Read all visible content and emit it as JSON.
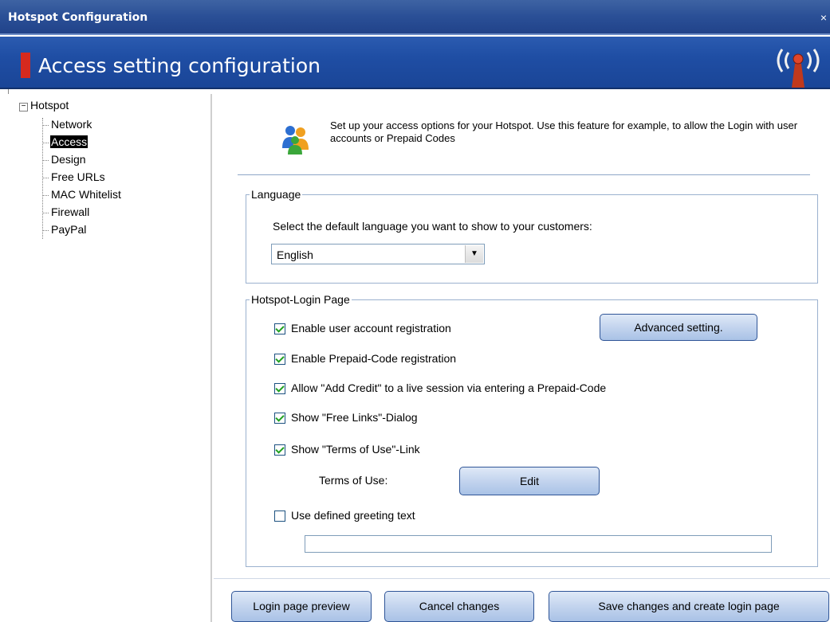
{
  "window": {
    "title": "Hotspot Configuration",
    "close_glyph": "×"
  },
  "header": {
    "title": "Access setting configuration",
    "icon": "antenna-icon"
  },
  "tree": {
    "root": "Hotspot",
    "items": [
      {
        "label": "Network"
      },
      {
        "label": "Access",
        "selected": true
      },
      {
        "label": "Design"
      },
      {
        "label": "Free URLs"
      },
      {
        "label": "MAC Whitelist"
      },
      {
        "label": "Firewall"
      },
      {
        "label": "PayPal"
      }
    ]
  },
  "info": {
    "icon": "users-icon",
    "text": "Set up your access options for your Hotspot. Use this feature for example, to allow the Login with user accounts or Prepaid Codes"
  },
  "language": {
    "legend": "Language",
    "prompt": "Select the default language you want to show to your customers:",
    "selected": "English"
  },
  "login": {
    "legend": "Hotspot-Login Page",
    "options": [
      {
        "label": "Enable user account registration",
        "checked": true
      },
      {
        "label": "Enable Prepaid-Code registration",
        "checked": true
      },
      {
        "label": "Allow \"Add Credit\" to a live session via entering a Prepaid-Code",
        "checked": true
      },
      {
        "label": "Show \"Free Links\"-Dialog",
        "checked": true
      },
      {
        "label": "Show \"Terms of Use\"-Link",
        "checked": true
      }
    ],
    "advanced_label": "Advanced setting.",
    "terms_label": "Terms of Use:",
    "edit_label": "Edit",
    "greeting_label": "Use defined greeting text",
    "greeting_checked": false,
    "greeting_value": ""
  },
  "footer": {
    "preview_label": "Login page preview",
    "cancel_label": "Cancel changes",
    "save_label": "Save changes and create login page"
  },
  "colors": {
    "header": "#1f4ea4",
    "accent_red": "#d62a1e",
    "check": "#21a121"
  }
}
